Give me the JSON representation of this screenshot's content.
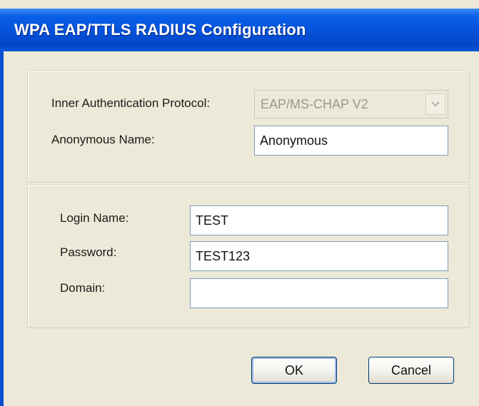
{
  "window": {
    "title": "WPA EAP/TTLS RADIUS Configuration"
  },
  "eap_group": {
    "inner_protocol": {
      "label": "Inner Authentication Protocol:",
      "value": "EAP/MS-CHAP V2",
      "enabled": false,
      "icon": "chevron-down-icon"
    },
    "anonymous_name": {
      "label": "Anonymous Name:",
      "value": "Anonymous"
    }
  },
  "credentials_group": {
    "login_name": {
      "label": "Login Name:",
      "value": "TEST"
    },
    "password": {
      "label": "Password:",
      "value": "TEST123"
    },
    "domain": {
      "label": "Domain:",
      "value": ""
    }
  },
  "buttons": {
    "ok_label": "OK",
    "cancel_label": "Cancel"
  },
  "colors": {
    "titlebar": "#0451d9",
    "dialog_background": "#ece9d8",
    "input_border": "#7f9db9",
    "button_border": "#003c74"
  }
}
